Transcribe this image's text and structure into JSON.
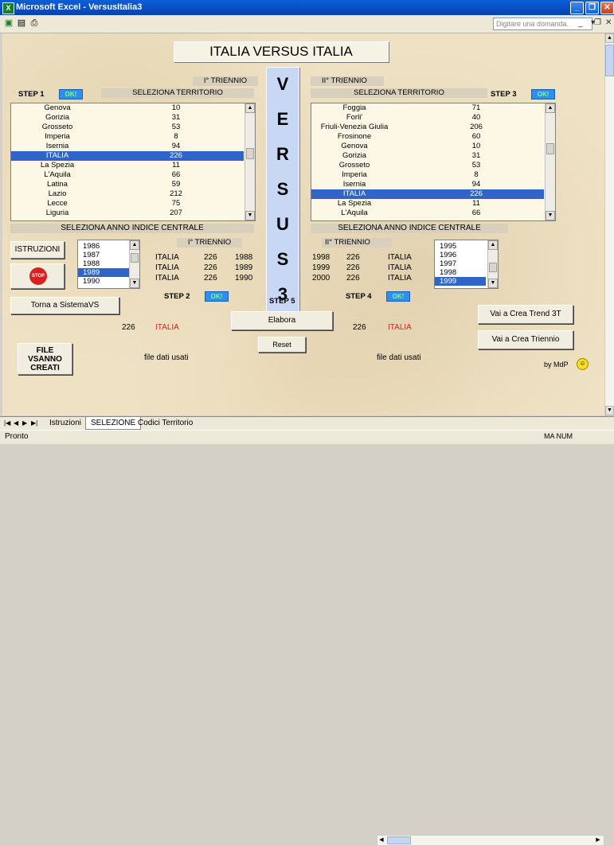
{
  "window": {
    "title": "Microsoft Excel - VersusItalia3",
    "app_icon": "X"
  },
  "toolbar": {
    "ask_placeholder": "Digitare una domanda."
  },
  "sheet": {
    "main_title": "ITALIA VERSUS ITALIA",
    "versus_letters": [
      "V",
      "E",
      "R",
      "S",
      "U",
      "S",
      "3"
    ],
    "left": {
      "step1": "STEP 1",
      "ok": "OK!",
      "triennio": "I° TRIENNIO",
      "seleziona_territorio": "SELEZIONA TERRITORIO",
      "territories": [
        {
          "name": "Genova",
          "value": "10"
        },
        {
          "name": "Gorizia",
          "value": "31"
        },
        {
          "name": "Grosseto",
          "value": "53"
        },
        {
          "name": "Imperia",
          "value": "8"
        },
        {
          "name": "Isernia",
          "value": "94"
        },
        {
          "name": "ITALIA",
          "value": "226",
          "selected": true
        },
        {
          "name": "La Spezia",
          "value": "11"
        },
        {
          "name": "L'Aquila",
          "value": "66"
        },
        {
          "name": "Latina",
          "value": "59"
        },
        {
          "name": "Lazio",
          "value": "212"
        },
        {
          "name": "Lecce",
          "value": "75"
        },
        {
          "name": "Liguria",
          "value": "207"
        }
      ],
      "seleziona_anno": "SELEZIONA ANNO INDICE CENTRALE",
      "years": [
        "1986",
        "1987",
        "1988",
        "1989",
        "1990"
      ],
      "years_selected": "1989",
      "triennio2": "I° TRIENNIO",
      "rows": [
        {
          "name": "ITALIA",
          "code": "226",
          "year": "1988"
        },
        {
          "name": "ITALIA",
          "code": "226",
          "year": "1989"
        },
        {
          "name": "ITALIA",
          "code": "226",
          "year": "1990"
        }
      ],
      "step2": "STEP 2",
      "code_result": "226",
      "name_result": "ITALIA",
      "file_label": "file dati usati"
    },
    "right": {
      "step3": "STEP 3",
      "ok": "OK!",
      "triennio": "II° TRIENNIO",
      "seleziona_territorio": "SELEZIONA TERRITORIO",
      "territories": [
        {
          "name": "Foggia",
          "value": "71"
        },
        {
          "name": "Forli'",
          "value": "40"
        },
        {
          "name": "Friuli-Venezia Giulia",
          "value": "206"
        },
        {
          "name": "Frosinone",
          "value": "60"
        },
        {
          "name": "Genova",
          "value": "10"
        },
        {
          "name": "Gorizia",
          "value": "31"
        },
        {
          "name": "Grosseto",
          "value": "53"
        },
        {
          "name": "Imperia",
          "value": "8"
        },
        {
          "name": "Isernia",
          "value": "94"
        },
        {
          "name": "ITALIA",
          "value": "226",
          "selected": true
        },
        {
          "name": "La Spezia",
          "value": "11"
        },
        {
          "name": "L'Aquila",
          "value": "66"
        }
      ],
      "seleziona_anno": "SELEZIONA ANNO INDICE CENTRALE",
      "years": [
        "1995",
        "1996",
        "1997",
        "1998",
        "1999"
      ],
      "years_selected": "1999",
      "triennio2": "II° TRIENNIO",
      "rows": [
        {
          "year": "1998",
          "code": "226",
          "name": "ITALIA"
        },
        {
          "year": "1999",
          "code": "226",
          "name": "ITALIA"
        },
        {
          "year": "2000",
          "code": "226",
          "name": "ITALIA"
        }
      ],
      "step4": "STEP 4",
      "code_result": "226",
      "name_result": "ITALIA",
      "file_label": "file dati usati"
    },
    "buttons": {
      "istruzioni": "ISTRUZIONI",
      "torna": "Torna a SistemaVS",
      "file_vsanno": "FILE VSANNO CREATI",
      "elabora": "Elabora",
      "reset": "Reset",
      "step5": "STEP 5",
      "crea_trend": "Vai a Crea Trend 3T",
      "crea_triennio": "Vai a Crea Triennio",
      "stop": "STOP"
    },
    "by": "by MdP"
  },
  "tabs": [
    "Istruzioni",
    "SELEZIONE",
    "Codici Territorio"
  ],
  "active_tab": "SELEZIONE",
  "status": {
    "left": "Pronto",
    "right": "MA NUM"
  }
}
